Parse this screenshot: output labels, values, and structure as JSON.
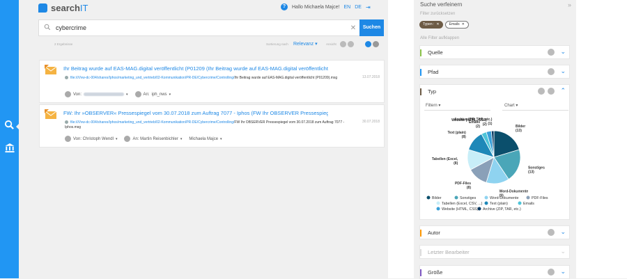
{
  "app": {
    "logo_text_a": "search",
    "logo_text_b": "IT"
  },
  "header": {
    "greeting": "Hallo Michaela Majce!",
    "lang_en": "EN",
    "lang_de": "DE"
  },
  "search": {
    "query": "cybercrime",
    "button": "Suchen"
  },
  "results_meta": {
    "count": "2 Ergebnisse",
    "sort_label": "Sortierung nach",
    "sort_value": "Relevanz",
    "view_label": "Ansicht"
  },
  "results": [
    {
      "title": "Ihr Beitrag wurde auf EAS-MAG.digital veröffentlicht (P01209 (Ihr Beitrag wurde auf EAS-MAG.digital veröffentlicht ...",
      "date": "13.07.2018",
      "path_link": "file://///vw-dc-004/shares/Iphos/marketing_und_vertrieb/02-Kommunikation/PR-DE/Cybercrime/Controlling/",
      "path_rest": "Ihr Beitrag wurde auf EAS-MAG.digital veröffentlicht (P01209).msg",
      "from_label": "Von:",
      "to_label": "An:",
      "to_value": "iph_nws"
    },
    {
      "title": "FW: Ihr »OBSERVER« Pressespiegel vom 30.07.2018 zum Auftrag 7077 - Iphos (FW Ihr OBSERVER Pressespiegel vom ...",
      "date": "30.07.2018",
      "path_link": "file://///vw-dc-004/shares/Iphos/marketing_und_vertrieb/02-Kommunikation/PR-DE/Cybercrime/Controlling/",
      "path_rest": "FW Ihr OBSERVER Pressespiegel vom 30.07.2018 zum Auftrag 7077 - Iphos.msg",
      "from_value": "Von: Christoph Wendl",
      "to_value": "An: Martin Reisenbichler",
      "cc_value": "Michaela Majce"
    }
  ],
  "panel": {
    "title": "Suche verfeinern",
    "reset": "Filter zurücksetzen",
    "tags": [
      {
        "label": "Typen :"
      },
      {
        "label": "Emails"
      }
    ],
    "expand_all": "Alle Filter aufklappen",
    "facets": [
      {
        "label": "Quelle",
        "color": "#8bc34a"
      },
      {
        "label": "Pfad",
        "color": "#2196f3"
      },
      {
        "label": "Typ",
        "color": "#6d5b45"
      },
      {
        "label": "Autor",
        "color": "#ff9800"
      },
      {
        "label": "Letzter Bearbeiter"
      },
      {
        "label": "Größe",
        "color": "#7e57c2"
      }
    ],
    "typ_dropdowns": {
      "filter": "Filtern",
      "chart": "Chart"
    }
  },
  "chart_data": {
    "type": "pie",
    "slices": [
      {
        "name": "Bilder",
        "label": "Bilder",
        "value": 13,
        "color": "#0b4f6c"
      },
      {
        "name": "Sonstiges",
        "label": "Sonstiges",
        "value": 13,
        "color": "#4aa6b8"
      },
      {
        "name": "Word-Dokumente",
        "label": "Word-Dokumente",
        "value": 9,
        "color": "#8fd3f0"
      },
      {
        "name": "PDF-Files",
        "label": "PDF-Files",
        "value": 8,
        "color": "#8aa0b8"
      },
      {
        "name": "Tabellen (Excel, CSV, ...)",
        "label": "Tabellen (Excel,",
        "value": 8,
        "color": "#c8eef8"
      },
      {
        "name": "Text (plain)",
        "label": "Text (plain)",
        "value": 8,
        "color": "#1e88b8"
      },
      {
        "name": "Emails",
        "label": "Emails",
        "value": 2,
        "color": "#4ec4d8"
      },
      {
        "name": "Website (HTML, CSS)",
        "label": "Website (HTML, CSS)",
        "value": 2,
        "color": "#3aa0d8"
      },
      {
        "name": "Archive (ZIP, TAR, etc.)",
        "label": "Archive (ZIP, TAR, etc.)",
        "value": 1,
        "color": "#0a3b64"
      }
    ]
  }
}
